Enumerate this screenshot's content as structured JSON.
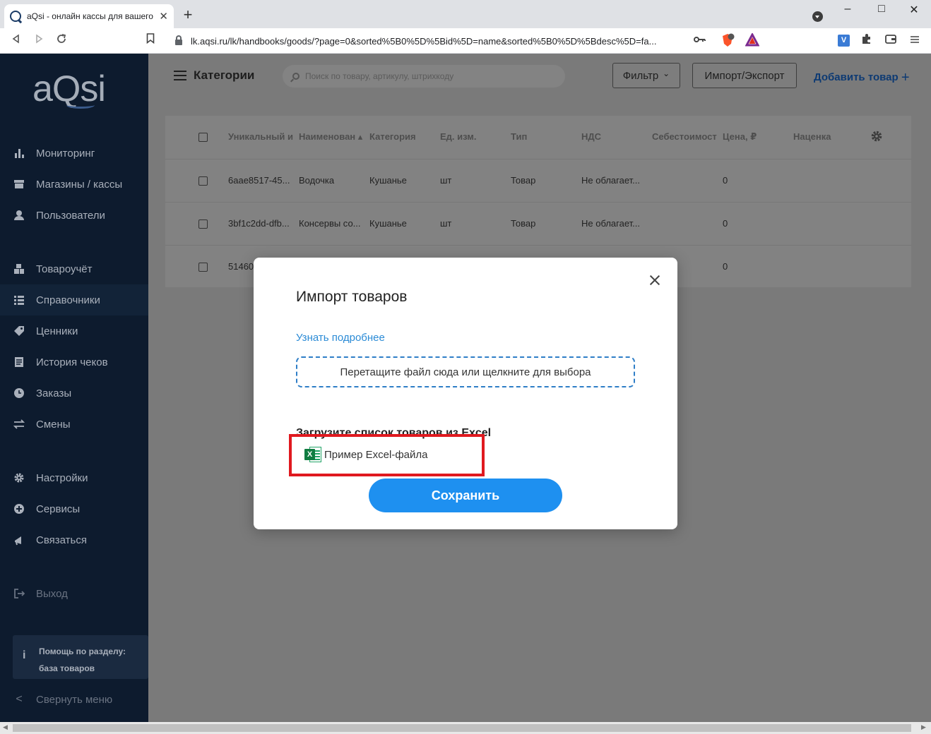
{
  "browser": {
    "tab_title": "aQsi - онлайн кассы для вашего",
    "tab_close": "✕",
    "new_tab": "+",
    "url": "lk.aqsi.ru/lk/handbooks/goods/?page=0&sorted%5B0%5D%5Bid%5D=name&sorted%5B0%5D%5Bdesc%5D=fa...",
    "ext_label": "V",
    "brave_badge": "1"
  },
  "sidebar": {
    "logo": "aQsi",
    "items": [
      {
        "label": "Мониторинг",
        "icon": "bar-chart-icon"
      },
      {
        "label": "Магазины / кассы",
        "icon": "store-icon"
      },
      {
        "label": "Пользователи",
        "icon": "user-icon"
      },
      {
        "label": "Товароучёт",
        "icon": "boxes-icon"
      },
      {
        "label": "Справочники",
        "icon": "list-icon"
      },
      {
        "label": "Ценники",
        "icon": "tag-icon"
      },
      {
        "label": "История чеков",
        "icon": "receipt-icon"
      },
      {
        "label": "Заказы",
        "icon": "clock-icon"
      },
      {
        "label": "Смены",
        "icon": "swap-icon"
      },
      {
        "label": "Настройки",
        "icon": "gear-icon"
      },
      {
        "label": "Сервисы",
        "icon": "plus-circle-icon"
      },
      {
        "label": "Связаться",
        "icon": "megaphone-icon"
      },
      {
        "label": "Выход",
        "icon": "logout-icon"
      }
    ],
    "help": {
      "line1": "Помощь по разделу:",
      "line2": "база товаров",
      "icon": "i"
    },
    "collapse": {
      "label": "Свернуть меню",
      "icon": "<"
    }
  },
  "header": {
    "title": "Категории",
    "search_placeholder": "Поиск по товару, артикулу, штрихкоду",
    "filter_label": "Фильтр",
    "filter_caret": "⌄",
    "import_export_label": "Импорт/Экспорт",
    "add_label": "Добавить товар",
    "add_plus": "+"
  },
  "table": {
    "columns": [
      "Уникальный и",
      "Наименован",
      "Категория",
      "Ед. изм.",
      "Тип",
      "НДС",
      "Себестоимост",
      "Цена, ₽",
      "Наценка"
    ],
    "sort_indicator": "▴",
    "rows": [
      [
        "6aae8517-45...",
        "Водочка",
        "Кушанье",
        "шт",
        "Товар",
        "Не облагает...",
        "",
        "0",
        ""
      ],
      [
        "3bf1c2dd-dfb...",
        "Консервы со...",
        "Кушанье",
        "шт",
        "Товар",
        "Не облагает...",
        "",
        "0",
        ""
      ],
      [
        "51460",
        "",
        "",
        "",
        "",
        "",
        "",
        "0",
        ""
      ]
    ]
  },
  "modal": {
    "title": "Импорт товаров",
    "learn_more": "Узнать подробнее",
    "dropzone_text": "Перетащите файл сюда или щелкните для выбора",
    "excel_heading": "Загрузите список товаров из Excel",
    "excel_link": "Пример Excel-файла",
    "excel_badge": "X",
    "save_label": "Сохранить",
    "highlight_color": "#e0191f",
    "accent_color": "#1e90f0"
  }
}
